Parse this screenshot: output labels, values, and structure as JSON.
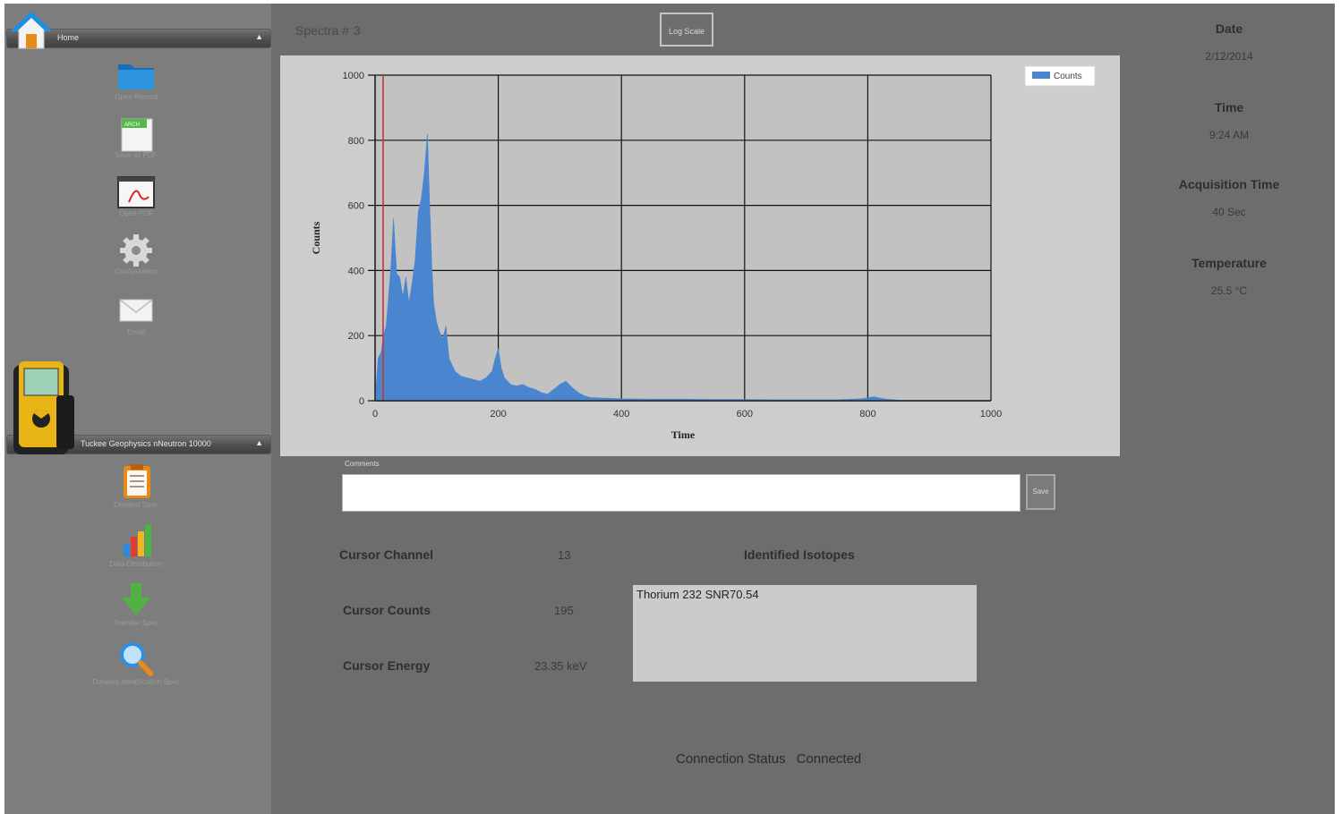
{
  "sidebar": {
    "home_label": "Home",
    "home_items": [
      {
        "label": "Open Record",
        "icon": "folder-icon"
      },
      {
        "label": "Save as PDF",
        "icon": "save-pdf-icon"
      },
      {
        "label": "Open PDF",
        "icon": "pdf-file-icon"
      },
      {
        "label": "Configuration",
        "icon": "gear-icon"
      },
      {
        "label": "Email",
        "icon": "envelope-icon"
      }
    ],
    "device_label": "Tuckee Geophysics nNeutron 10000",
    "device_items": [
      {
        "label": "Detailed Spec",
        "icon": "clipboard-icon"
      },
      {
        "label": "Data Distribution",
        "icon": "bar-chart-icon"
      },
      {
        "label": "Transfer Spec",
        "icon": "download-arrow-icon"
      },
      {
        "label": "Detailed Identification Spec",
        "icon": "magnifier-icon"
      }
    ]
  },
  "header": {
    "spectra_label": "Spectra #",
    "spectra_number": "3",
    "log_scale_button": "Log Scale"
  },
  "info": {
    "date_label": "Date",
    "date_value": "2/12/2014",
    "time_label": "Time",
    "time_value": "9:24 AM",
    "acq_label": "Acquisition Time",
    "acq_value": "40 Sec",
    "temp_label": "Temperature",
    "temp_value": "25.5 °C"
  },
  "comments": {
    "label": "Comments",
    "value": "",
    "save_button": "Save"
  },
  "cursor": {
    "channel_label": "Cursor Channel",
    "channel_value": "13",
    "counts_label": "Cursor Counts",
    "counts_value": "195",
    "energy_label": "Cursor Energy",
    "energy_value": "23.35 keV"
  },
  "isotopes": {
    "label": "Identified Isotopes",
    "items": [
      "Thorium 232 SNR70.54"
    ]
  },
  "connection": {
    "label": "Connection Status",
    "value": "Connected"
  },
  "chart_data": {
    "type": "area",
    "xlabel": "Time",
    "ylabel": "Counts",
    "xlim": [
      0,
      1000
    ],
    "ylim": [
      0,
      1000
    ],
    "xticks": [
      "0",
      "200",
      "400",
      "600",
      "800",
      "1000"
    ],
    "yticks": [
      "0",
      "200",
      "400",
      "600",
      "800",
      "1000"
    ],
    "grid": true,
    "legend_position": "top-right",
    "cursor_x": 13,
    "series": [
      {
        "name": "Counts",
        "color": "#4a86d0",
        "x": [
          0,
          5,
          10,
          13,
          18,
          22,
          26,
          30,
          35,
          40,
          45,
          50,
          55,
          60,
          65,
          70,
          75,
          80,
          85,
          88,
          92,
          95,
          100,
          105,
          110,
          115,
          120,
          125,
          130,
          140,
          150,
          160,
          170,
          180,
          190,
          195,
          200,
          205,
          210,
          220,
          230,
          240,
          250,
          260,
          270,
          280,
          290,
          300,
          310,
          320,
          330,
          340,
          350,
          370,
          400,
          450,
          500,
          550,
          600,
          650,
          700,
          750,
          790,
          800,
          810,
          820,
          830,
          850,
          900,
          950,
          1000
        ],
        "y": [
          0,
          130,
          150,
          195,
          230,
          320,
          420,
          560,
          390,
          380,
          320,
          380,
          300,
          360,
          430,
          580,
          620,
          700,
          820,
          640,
          420,
          300,
          240,
          210,
          190,
          230,
          130,
          110,
          90,
          75,
          70,
          65,
          60,
          70,
          90,
          130,
          160,
          100,
          70,
          50,
          45,
          50,
          40,
          35,
          25,
          20,
          35,
          50,
          60,
          40,
          25,
          15,
          10,
          8,
          6,
          5,
          5,
          4,
          4,
          3,
          3,
          3,
          6,
          9,
          12,
          8,
          5,
          2,
          1,
          0,
          0
        ]
      }
    ]
  }
}
